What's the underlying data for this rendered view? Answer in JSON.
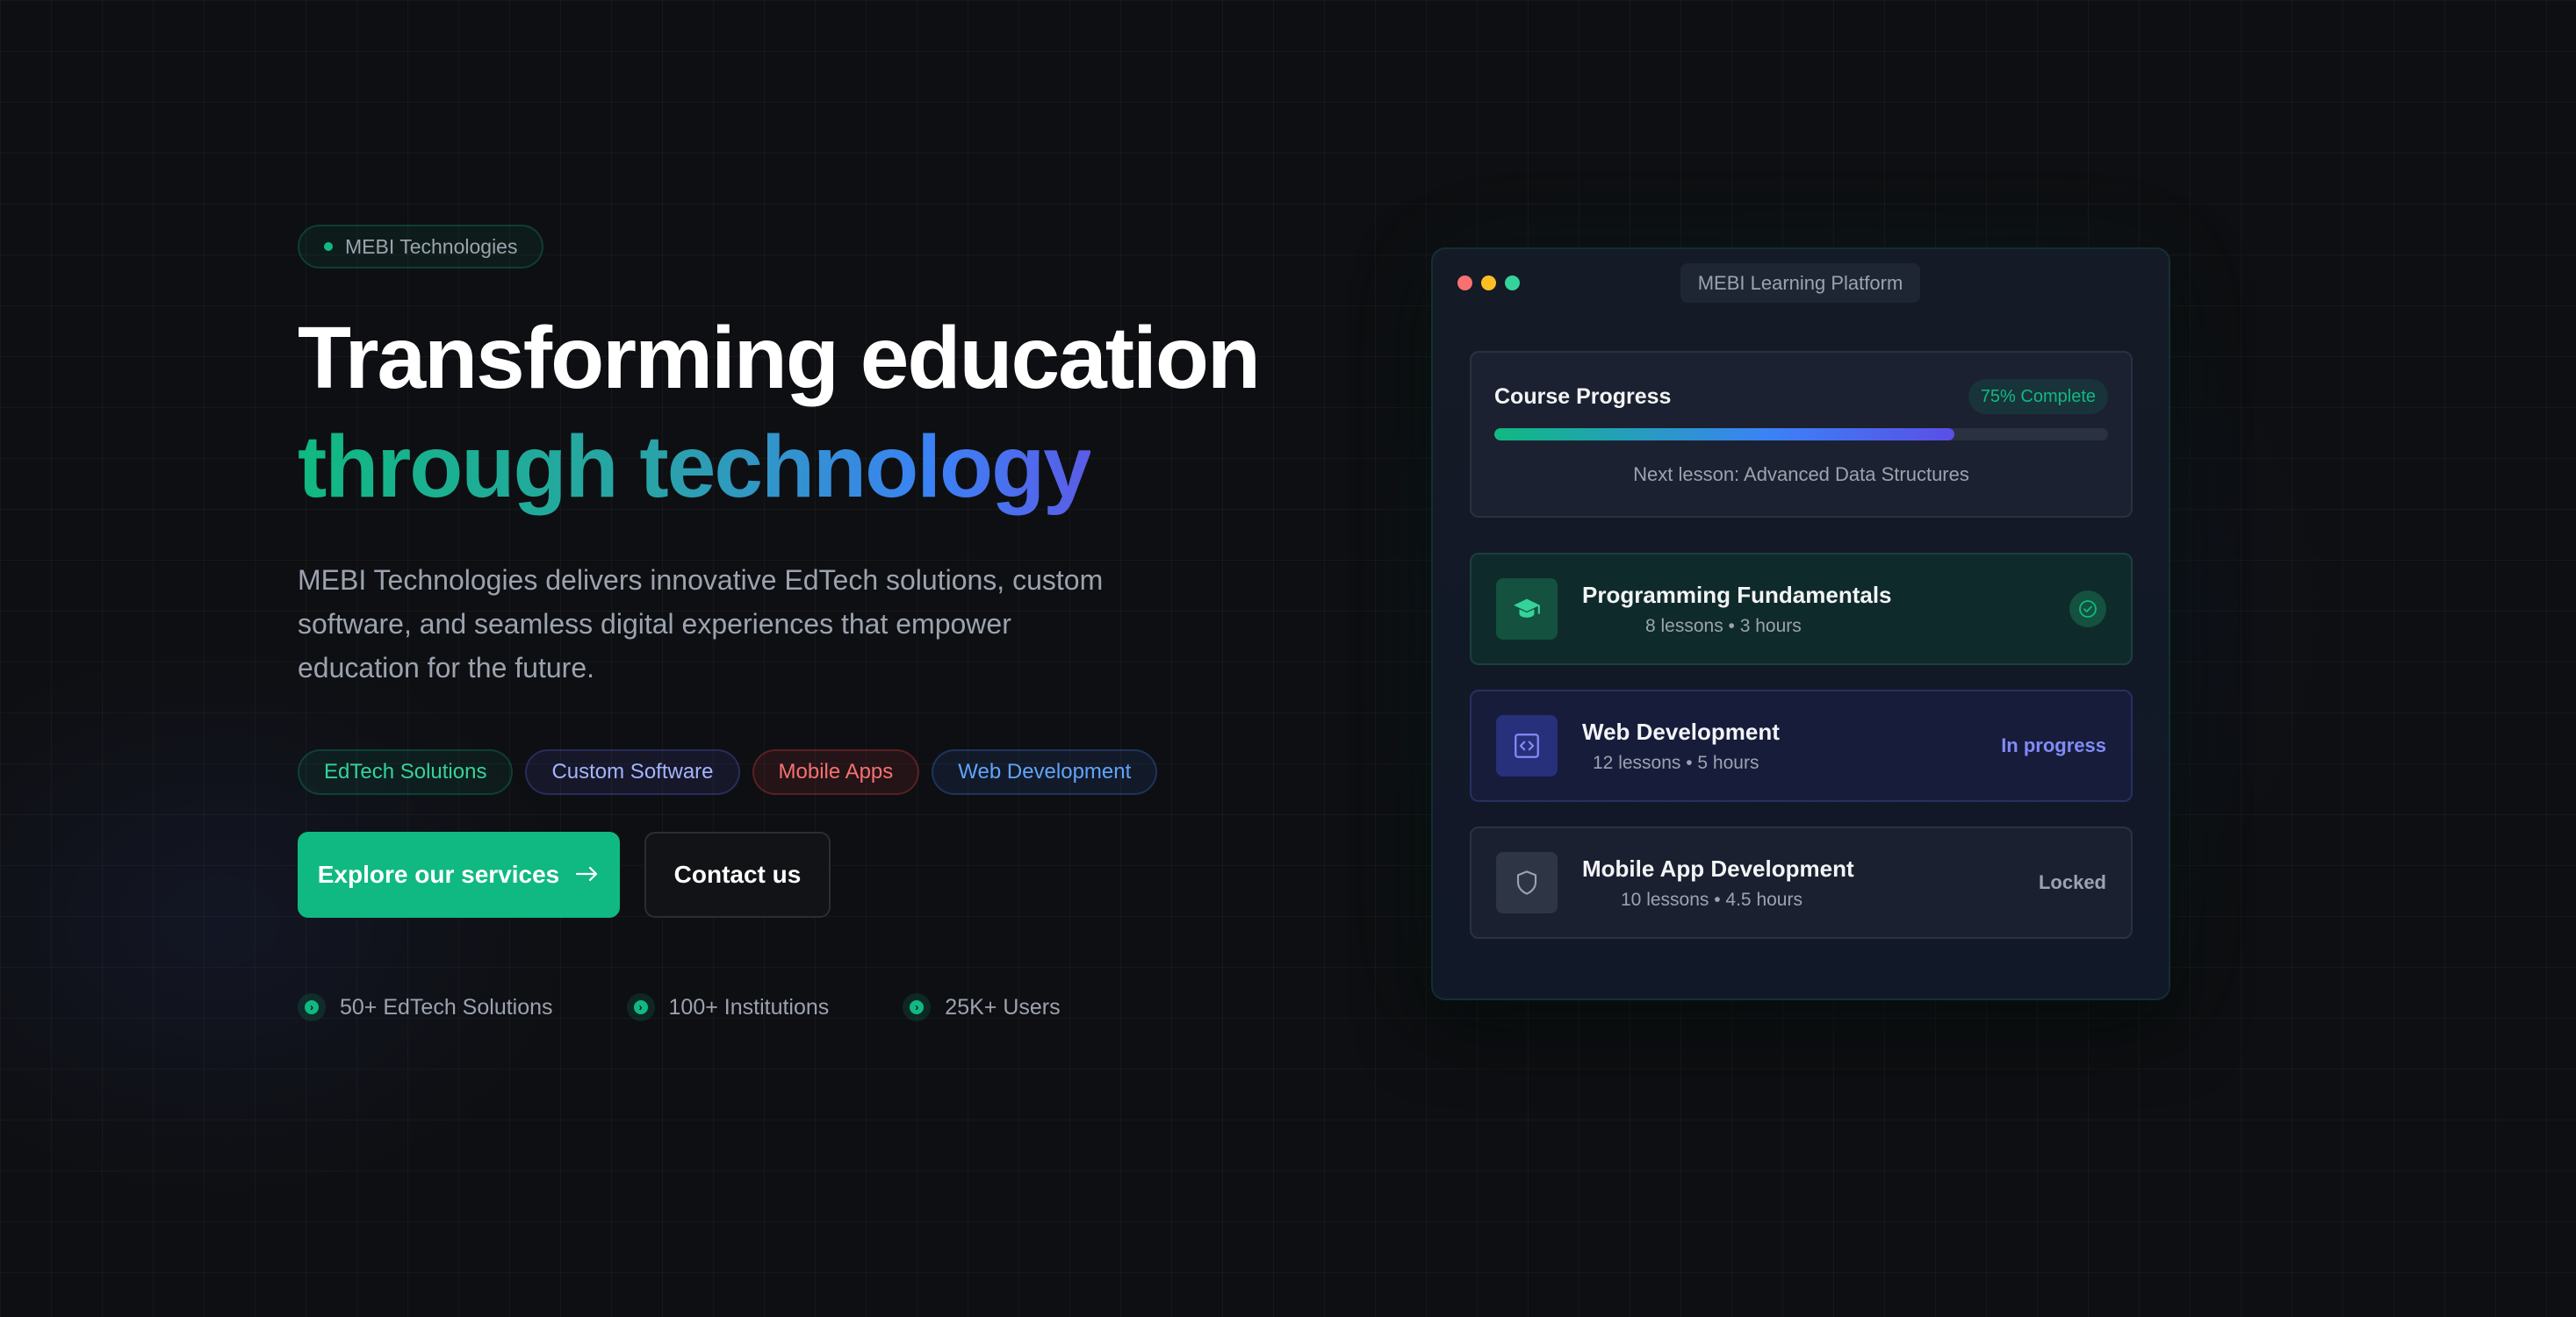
{
  "hero": {
    "badge": "MEBI Technologies",
    "headline_line1": "Transforming education",
    "headline_line2": "through technology",
    "lead": "MEBI Technologies delivers innovative EdTech solutions, custom software, and seamless digital experiences that empower education for the future."
  },
  "tags": [
    {
      "label": "EdTech Solutions",
      "color": "#34d399"
    },
    {
      "label": "Custom Software",
      "color": "#a5b4fc"
    },
    {
      "label": "Mobile Apps",
      "color": "#f87171"
    },
    {
      "label": "Web Development",
      "color": "#60a5fa"
    }
  ],
  "cta": {
    "primary_label": "Explore our services",
    "primary_icon": "arrow-right-icon",
    "secondary_label": "Contact us"
  },
  "stats": [
    {
      "label": "50+ EdTech Solutions",
      "icon": "arrow-circle-icon"
    },
    {
      "label": "100+ Institutions",
      "icon": "arrow-circle-icon"
    },
    {
      "label": "25K+ Users",
      "icon": "arrow-circle-icon"
    }
  ],
  "window": {
    "title": "MEBI Learning Platform",
    "dot_colors": [
      "#f87171",
      "#fbbf24",
      "#34d399"
    ],
    "progress": {
      "title": "Course Progress",
      "badge": "75% Complete",
      "value": 0.75,
      "next_lesson": "Next lesson: Advanced Data Structures"
    },
    "courses": [
      {
        "name": "Programming Fundamentals",
        "meta": "8 lessons • 3 hours",
        "icon": "graduation-cap-icon",
        "status": "check-icon"
      },
      {
        "name": "Web Development",
        "meta": "12 lessons • 5 hours",
        "icon": "code-icon",
        "status": "In progress"
      },
      {
        "name": "Mobile App Development",
        "meta": "10 lessons • 4.5 hours",
        "icon": "shield-icon",
        "status": "Locked"
      }
    ]
  },
  "colors": {
    "accent": "#10b981",
    "background": "#0e0f12",
    "indigo": "#818cf8"
  }
}
